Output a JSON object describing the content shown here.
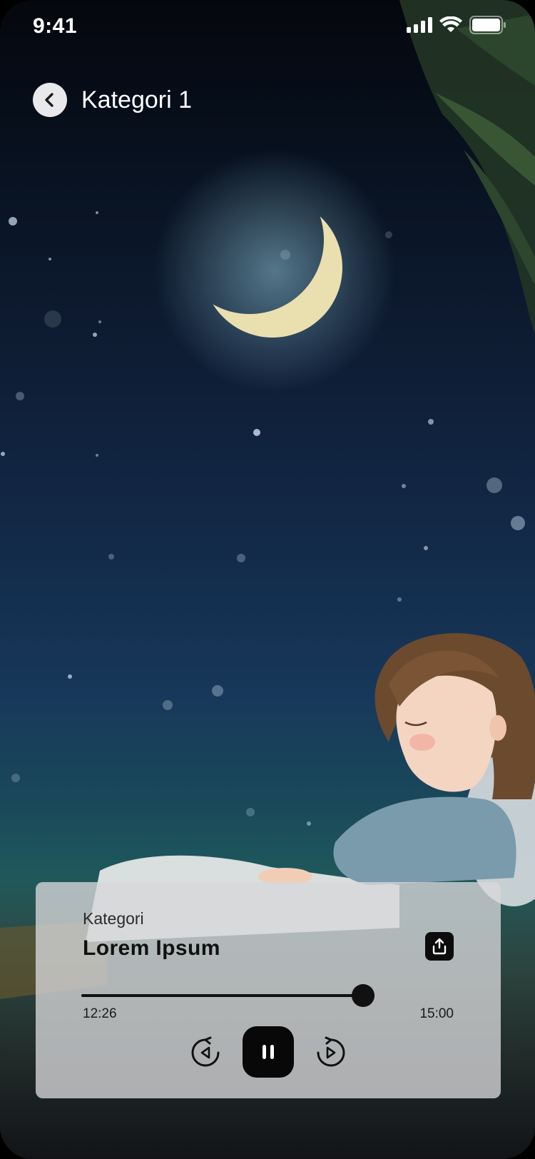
{
  "status_bar": {
    "time": "9:41",
    "icons": [
      "signal-icon",
      "wifi-icon",
      "battery-icon"
    ]
  },
  "header": {
    "title": "Kategori 1",
    "back_icon": "chevron-left-icon"
  },
  "player": {
    "category": "Kategori",
    "title": "Lorem Ipsum",
    "elapsed": "12:26",
    "duration": "15:00",
    "progress_fraction": 0.75,
    "share_icon": "share-upload-icon",
    "controls": {
      "rewind_icon": "rewind-icon",
      "pause_icon": "pause-icon",
      "forward_icon": "forward-icon"
    }
  },
  "colors": {
    "player_bg": "#d7d7da",
    "accent": "#111111",
    "sky_top": "#05070d",
    "sky_mid": "#132b4a",
    "moon": "#e8ddb0"
  }
}
